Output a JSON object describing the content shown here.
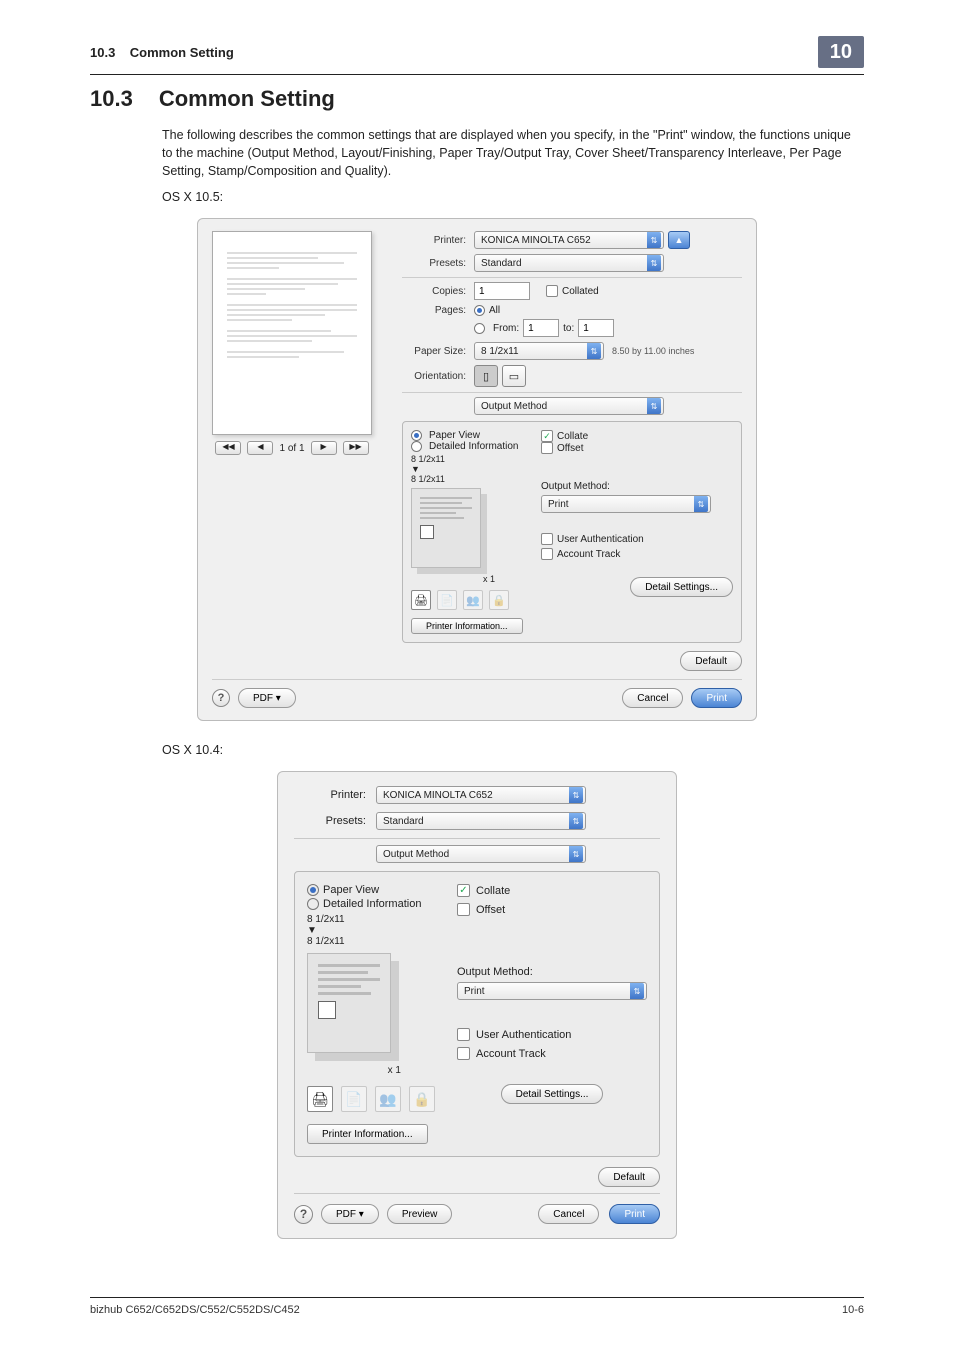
{
  "header": {
    "section": "10.3",
    "title": "Common Setting",
    "chapter": "10"
  },
  "heading": {
    "num": "10.3",
    "title": "Common Setting"
  },
  "intro": "The following describes the common settings that are displayed when you specify, in the \"Print\" window, the functions unique to the machine (Output Method, Layout/Finishing, Paper Tray/Output Tray, Cover Sheet/Transparency Interleave, Per Page Setting, Stamp/Composition and Quality).",
  "os_labels": {
    "v105": "OS X 10.5:",
    "v104": "OS X 10.4:"
  },
  "dlg105": {
    "labels": {
      "printer": "Printer:",
      "presets": "Presets:",
      "copies": "Copies:",
      "pages": "Pages:",
      "paper_size": "Paper Size:",
      "orientation": "Orientation:"
    },
    "printer_value": "KONICA MINOLTA C652",
    "presets_value": "Standard",
    "copies_value": "1",
    "collated": "Collated",
    "pages_all": "All",
    "pages_from": "From:",
    "from_value": "1",
    "pages_to": "to:",
    "to_value": "1",
    "paper_size_value": "8 1/2x11",
    "paper_size_note": "8.50 by 11.00 inches",
    "section_select": "Output Method",
    "paper_view": "Paper View",
    "detailed_info": "Detailed Information",
    "dim1": "8 1/2x11",
    "dim2": "8 1/2x11",
    "collate": "Collate",
    "offset": "Offset",
    "output_method_label": "Output Method:",
    "output_method_value": "Print",
    "user_auth": "User Authentication",
    "account_track": "Account Track",
    "detail_settings": "Detail Settings...",
    "printer_info": "Printer Information...",
    "default": "Default",
    "pdf": "PDF ▾",
    "cancel": "Cancel",
    "print": "Print",
    "pager": "1 of 1",
    "xn": "x 1"
  },
  "dlg104": {
    "labels": {
      "printer": "Printer:",
      "presets": "Presets:"
    },
    "printer_value": "KONICA MINOLTA C652",
    "presets_value": "Standard",
    "section_select": "Output Method",
    "paper_view": "Paper View",
    "detailed_info": "Detailed Information",
    "dim1": "8 1/2x11",
    "dim2": "8 1/2x11",
    "collate": "Collate",
    "offset": "Offset",
    "output_method_label": "Output Method:",
    "output_method_value": "Print",
    "user_auth": "User Authentication",
    "account_track": "Account Track",
    "detail_settings": "Detail Settings...",
    "printer_info": "Printer Information...",
    "default": "Default",
    "pdf": "PDF ▾",
    "preview": "Preview",
    "cancel": "Cancel",
    "print": "Print",
    "xn": "x 1"
  },
  "footer": {
    "product": "bizhub C652/C652DS/C552/C552DS/C452",
    "page": "10-6"
  }
}
